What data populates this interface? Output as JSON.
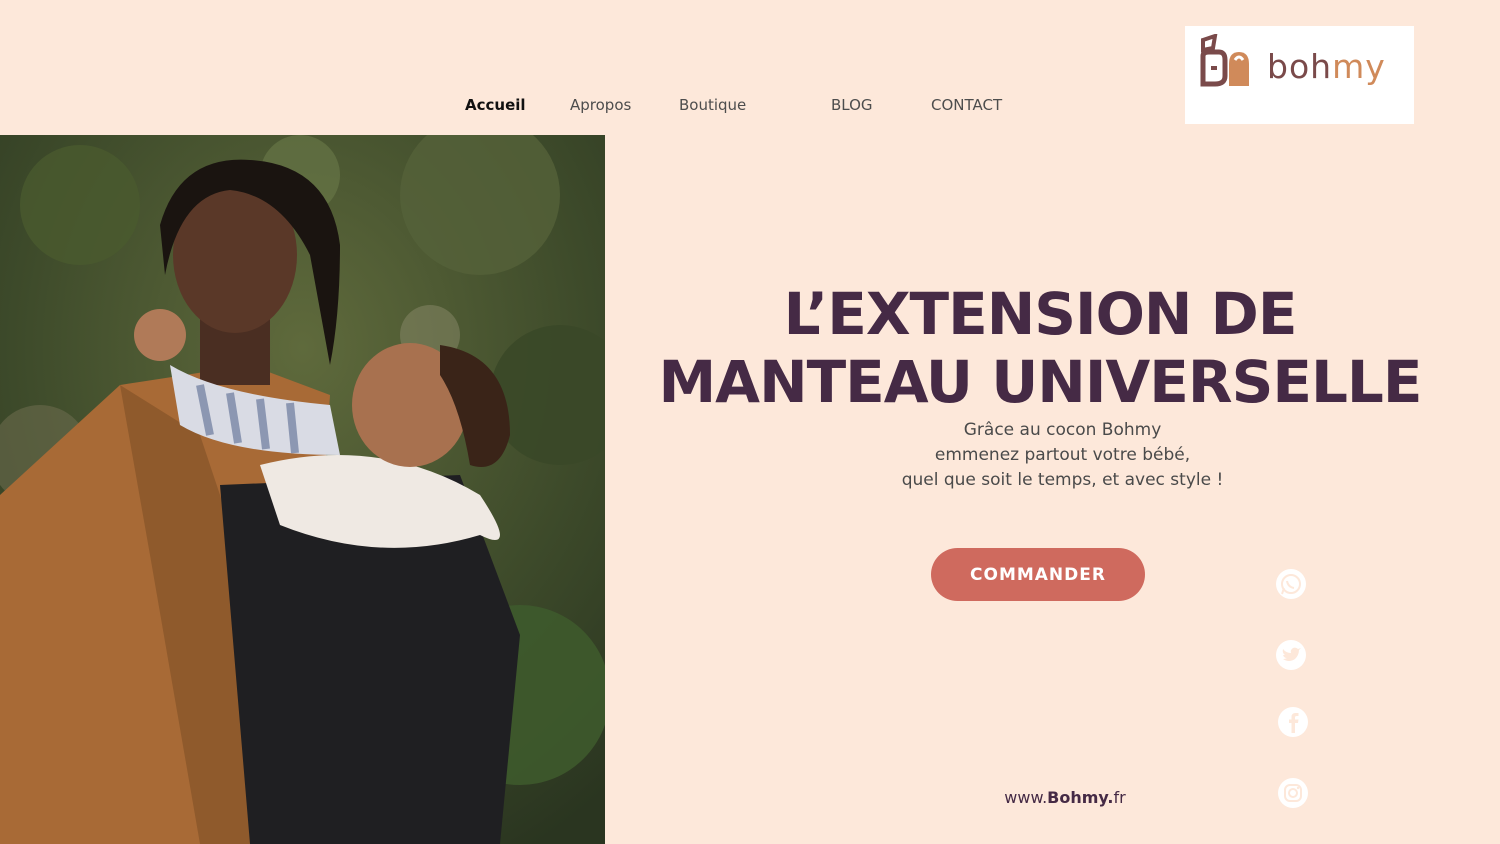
{
  "nav": {
    "items": [
      {
        "label": "Accueil",
        "active": true
      },
      {
        "label": "Apropos",
        "active": false
      },
      {
        "label": "Boutique",
        "active": false
      },
      {
        "label": "BLOG",
        "active": false
      },
      {
        "label": "CONTACT",
        "active": false
      }
    ]
  },
  "logo": {
    "part1": "boh",
    "part2": "my",
    "icon": "bohmy-logo-icon"
  },
  "hero": {
    "title_line1": "L’EXTENSION DE",
    "title_line2": "MANTEAU UNIVERSELLE",
    "subtitle_line1": "Grâce au cocon Bohmy",
    "subtitle_line2": "emmenez partout votre bébé,",
    "subtitle_line3": "quel que soit le temps, et avec style !",
    "cta_label": "COMMANDER"
  },
  "social": [
    "whatsapp-icon",
    "twitter-icon",
    "facebook-icon",
    "instagram-icon"
  ],
  "footer": {
    "url_prefix": "www.",
    "url_brand": "Bohmy.",
    "url_suffix": "fr"
  },
  "colors": {
    "background": "#fde8da",
    "headline": "#452a45",
    "cta": "#cf6a5e",
    "logo_brown": "#7a4a4a",
    "logo_orange": "#d08a5a"
  }
}
